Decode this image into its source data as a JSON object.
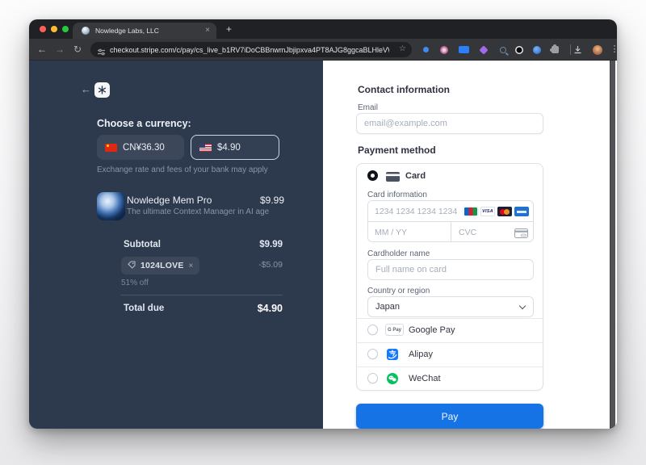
{
  "browser": {
    "tab_title": "Nowledge Labs, LLC",
    "url": "checkout.stripe.com/c/pay/cs_live_b1RV7iDoCBBnwmJbjipxva4PT8AJG8ggcaBLHleVW...",
    "icons": {
      "back": "←",
      "forward": "→",
      "reload": "↻",
      "bookmark_star": "☆",
      "tab_close": "×",
      "new_tab": "+",
      "menu": "⋮"
    }
  },
  "summary": {
    "currency_heading": "Choose a currency:",
    "currencies": [
      {
        "label": "CN¥36.30",
        "selected": false
      },
      {
        "label": "$4.90",
        "selected": true
      }
    ],
    "exchange_note": "Exchange rate and fees of your bank may apply",
    "product": {
      "name": "Nowledge Mem Pro",
      "description": "The ultimate Context Manager in AI age",
      "price": "$9.99"
    },
    "subtotal_label": "Subtotal",
    "subtotal_value": "$9.99",
    "coupon": {
      "code": "1024LOVE",
      "remove": "×",
      "discount": "-$5.09",
      "note": "51% off"
    },
    "total_label": "Total due",
    "total_value": "$4.90"
  },
  "payment": {
    "contact_heading": "Contact information",
    "email_label": "Email",
    "email_placeholder": "email@example.com",
    "payment_heading": "Payment method",
    "card": {
      "option_label": "Card",
      "info_label": "Card information",
      "number_placeholder": "1234 1234 1234 1234",
      "expiry_placeholder": "MM / YY",
      "cvc_placeholder": "CVC",
      "visa_text": "VISA",
      "name_label": "Cardholder name",
      "name_placeholder": "Full name on card",
      "country_label": "Country or region",
      "country_value": "Japan"
    },
    "wallets": [
      {
        "name": "Google Pay",
        "badge": "G Pay"
      },
      {
        "name": "Alipay"
      },
      {
        "name": "WeChat"
      }
    ],
    "pay_label": "Pay"
  },
  "colors": {
    "pay_button_blue": "#1673e6",
    "summary_panel_navy": "#2d394d",
    "alipay_blue": "#1677ff",
    "wechat_green": "#07c160",
    "mastercard_red": "#eb001b",
    "mastercard_orange": "#f79e1b",
    "visa_navy": "#1a1f71"
  }
}
